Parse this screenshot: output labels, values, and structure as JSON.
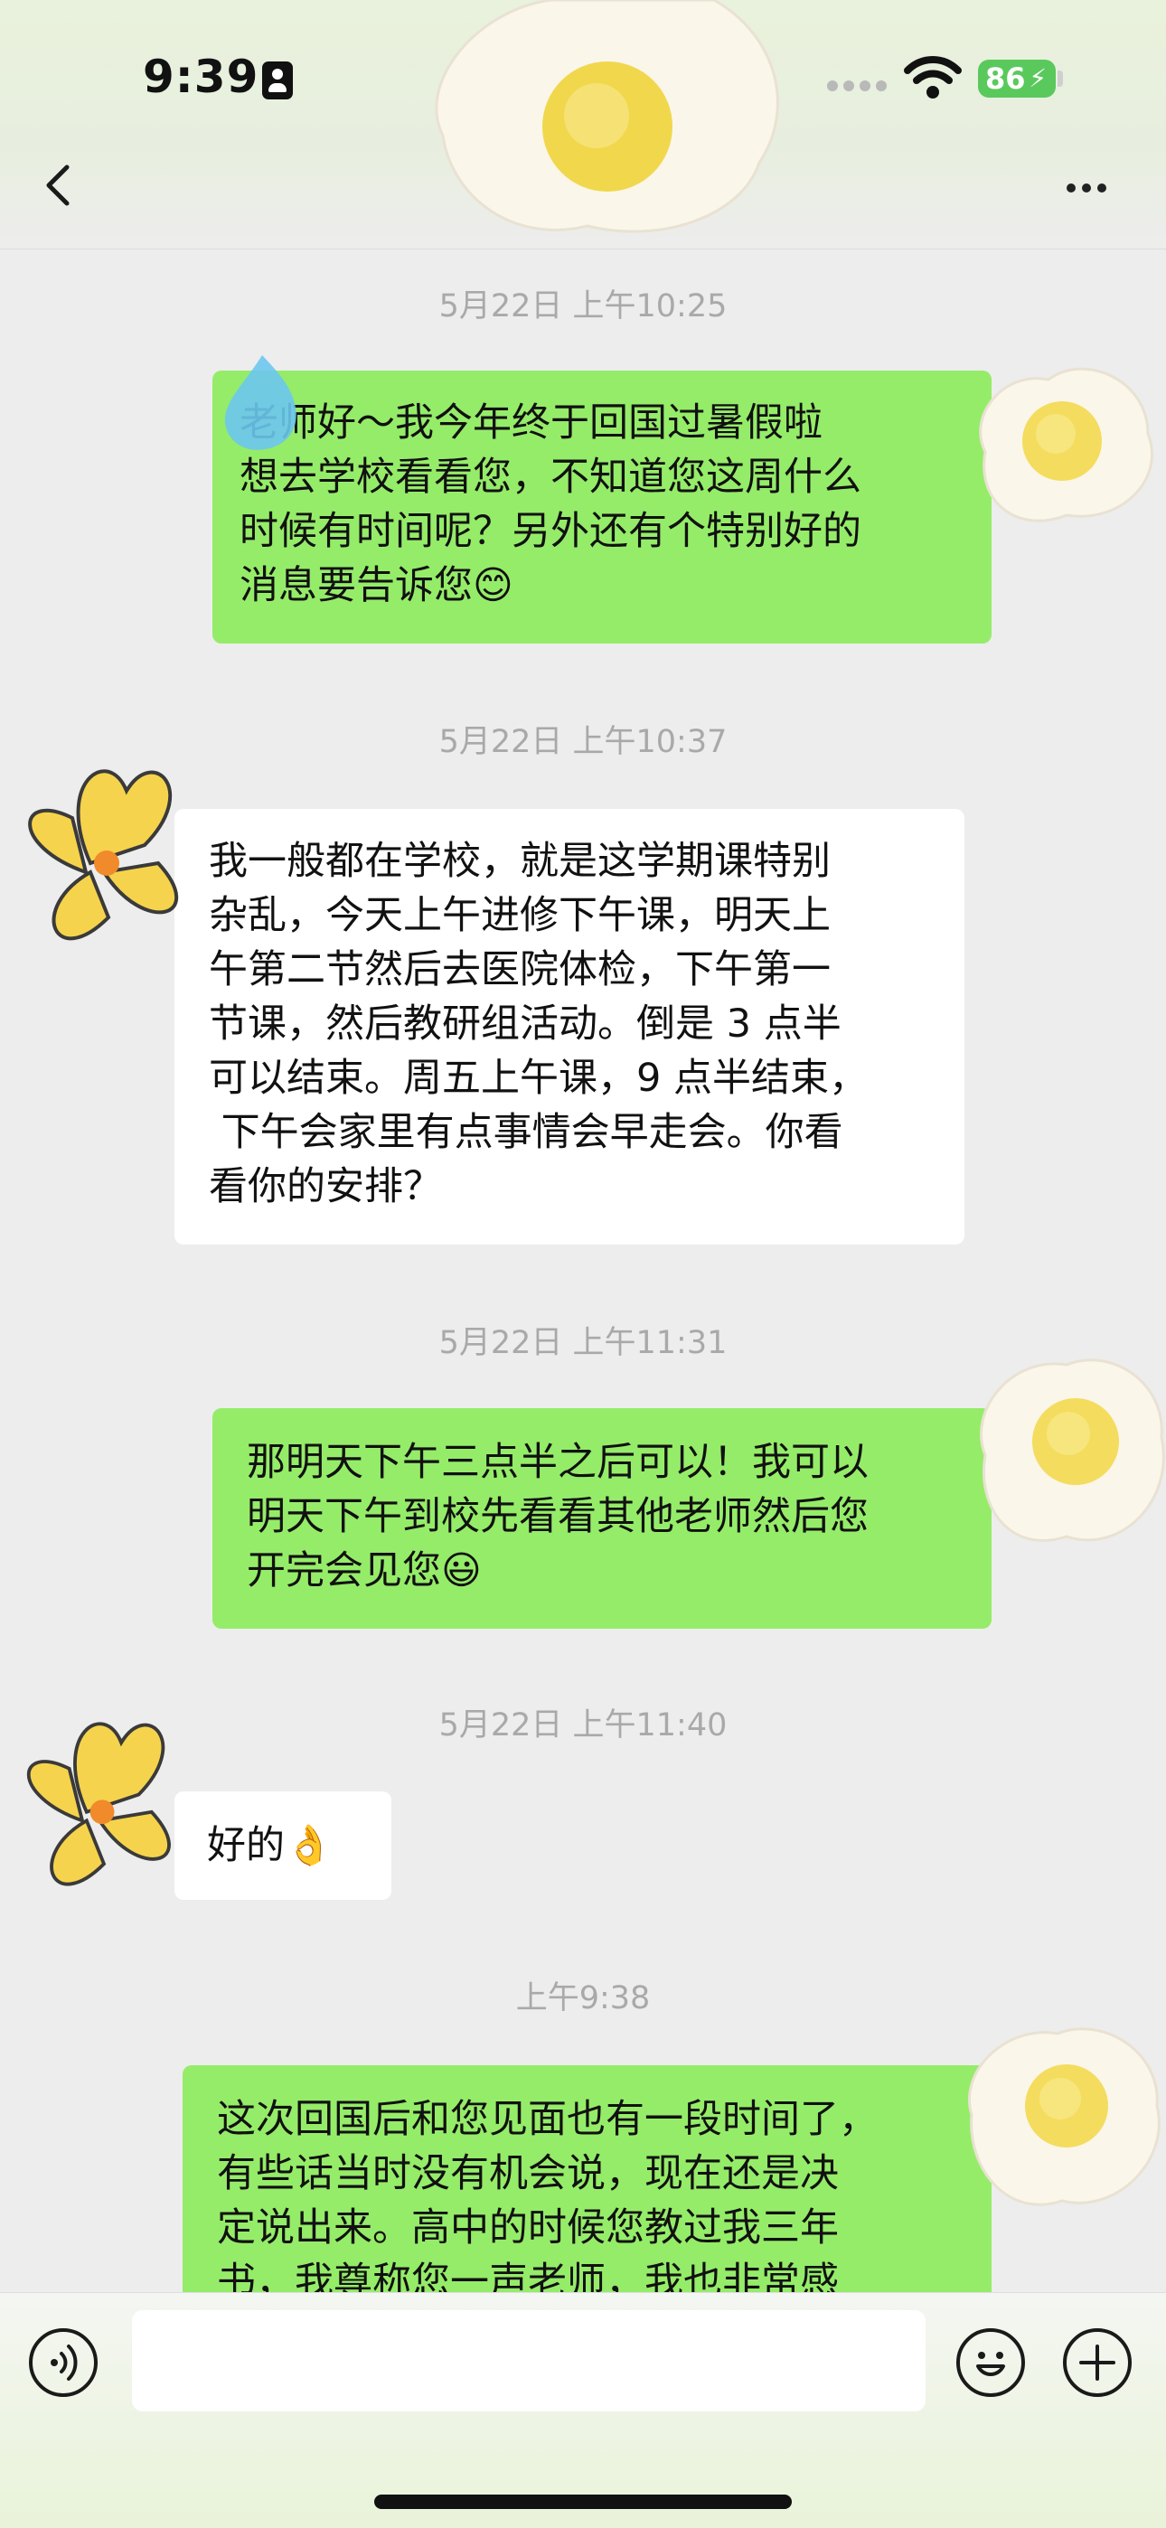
{
  "status_bar": {
    "time": "9:39",
    "battery": "86"
  },
  "nav": {
    "back_icon": "chevron-left-icon",
    "more_icon": "more-dots-icon"
  },
  "chat": {
    "messages": [
      {
        "timestamp": "5月22日 上午10:25",
        "side": "me",
        "lines": [
          "老师好～我今年终于回国过暑假啦",
          "想去学校看看您，不知道您这周什么",
          "时候有时间呢？另外还有个特别好的",
          "消息要告诉您😊"
        ]
      },
      {
        "timestamp": "5月22日 上午10:37",
        "side": "them",
        "lines": [
          "我一般都在学校，就是这学期课特别",
          "杂乱，今天上午进修下午课，明天上",
          "午第二节然后去医院体检，下午第一",
          "节课，然后教研组活动。倒是 3 点半",
          "可以结束。周五上午课，9 点半结束，",
          " 下午会家里有点事情会早走会。你看",
          "看你的安排？"
        ]
      },
      {
        "timestamp": "5月22日 上午11:31",
        "side": "me",
        "lines": [
          "那明天下午三点半之后可以！我可以",
          "明天下午到校先看看其他老师然后您",
          "开完会见您😃"
        ]
      },
      {
        "timestamp": "5月22日 上午11:40",
        "side": "them",
        "lines": [
          "好的👌"
        ]
      },
      {
        "timestamp": "上午9:38",
        "side": "me",
        "lines": [
          "这次回国后和您见面也有一段时间了，",
          "有些话当时没有机会说，现在还是决",
          "定说出来。高中的时候您教过我三年",
          "书，我尊称您一声老师，我也非常感"
        ]
      }
    ]
  },
  "input_bar": {
    "voice_icon": "voice-icon",
    "emoji_icon": "emoji-icon",
    "plus_icon": "plus-icon",
    "text": ""
  }
}
